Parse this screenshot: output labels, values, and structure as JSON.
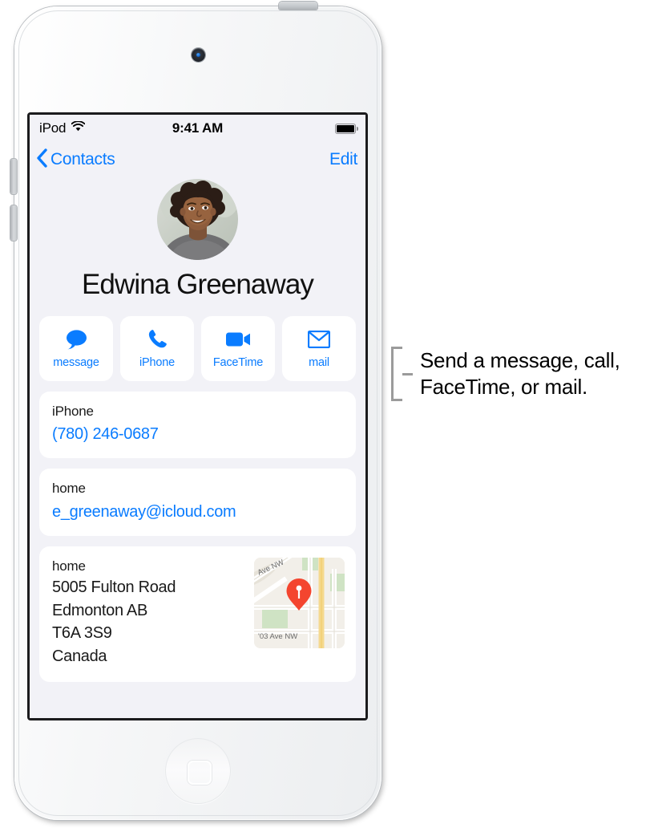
{
  "device": {
    "kind": "ipod-touch",
    "frame_color": "#f3f4f5",
    "screen_background": "#f2f2f7"
  },
  "status_bar": {
    "carrier": "iPod",
    "wifi_icon": "wifi-icon",
    "time": "9:41 AM",
    "battery_icon": "battery-full-icon",
    "battery_level_percent": 100
  },
  "nav_bar": {
    "back_icon": "chevron-left-icon",
    "back_label": "Contacts",
    "edit_label": "Edit",
    "tint_color": "#0a7cff"
  },
  "contact": {
    "avatar_icon": "contact-photo",
    "name": "Edwina Greenaway"
  },
  "actions": [
    {
      "icon": "message-bubble-icon",
      "label": "message"
    },
    {
      "icon": "phone-handset-icon",
      "label": "iPhone"
    },
    {
      "icon": "video-camera-icon",
      "label": "FaceTime"
    },
    {
      "icon": "envelope-icon",
      "label": "mail"
    }
  ],
  "fields": {
    "phone": {
      "label": "iPhone",
      "value": "(780) 246-0687"
    },
    "email": {
      "label": "home",
      "value": "e_greenaway@icloud.com"
    },
    "address": {
      "label": "home",
      "street": "5005 Fulton Road",
      "city_province": "Edmonton AB",
      "postal_code": "T6A 3S9",
      "country": "Canada",
      "map_icon": "map-thumbnail",
      "map_pin_icon": "map-pin-icon",
      "map_pin_color": "#f44336",
      "map_labels": {
        "top_street": "Ave NW",
        "bottom_street": "'03 Ave NW"
      }
    }
  },
  "callout": {
    "bracket_icon": "callout-bracket-icon",
    "text": "Send a message, call, FaceTime, or mail.",
    "line_color": "#9b9b9b"
  }
}
